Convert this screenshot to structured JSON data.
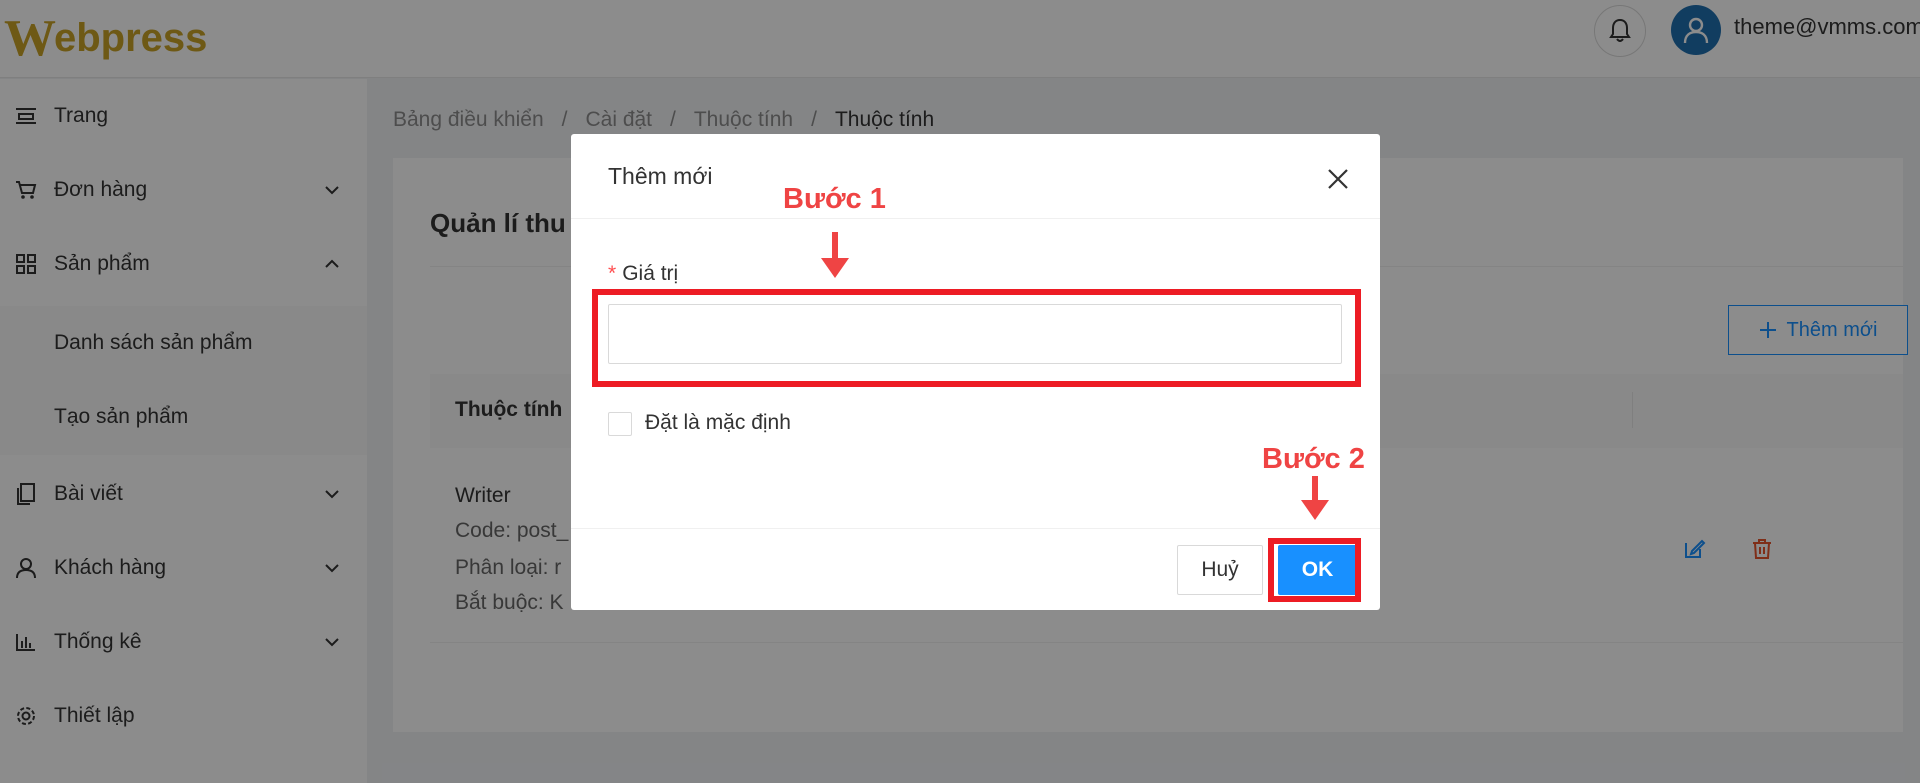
{
  "header": {
    "logo_w": "W",
    "logo_rest": "ebpress",
    "user_email": "theme@vmms.com"
  },
  "sidebar": {
    "items": [
      {
        "label": "Trang",
        "icon": "page-icon"
      },
      {
        "label": "Đơn hàng",
        "icon": "cart-icon",
        "expanded": false
      },
      {
        "label": "Sản phẩm",
        "icon": "grid-icon",
        "expanded": true
      },
      {
        "label": "Bài viết",
        "icon": "document-icon",
        "expanded": false
      },
      {
        "label": "Khách hàng",
        "icon": "user-icon",
        "expanded": false
      },
      {
        "label": "Thống kê",
        "icon": "bar-chart-icon",
        "expanded": false
      },
      {
        "label": "Thiết lập",
        "icon": "gear-icon"
      }
    ],
    "subitems": [
      {
        "label": "Danh sách sản phẩm"
      },
      {
        "label": "Tạo sản phẩm"
      }
    ]
  },
  "breadcrumb": [
    "Bảng điều khiển",
    "Cài đặt",
    "Thuộc tính",
    "Thuộc tính"
  ],
  "main": {
    "title": "Quản lí thu",
    "add_button": "Thêm mới",
    "table_header": "Thuộc tính",
    "row": {
      "title": "Writer",
      "code": "Code:  post_",
      "type": "Phân loại:  r",
      "required": "Bắt buộc:  K"
    }
  },
  "modal": {
    "title": "Thêm mới",
    "required_mark": "*",
    "field_label": "Giá trị",
    "value": "",
    "checkbox_label": "Đặt là mặc định",
    "checkbox_checked": false,
    "cancel": "Huỷ",
    "ok": "OK"
  },
  "annotations": {
    "step1": "Bước 1",
    "step2": "Bước 2",
    "color": "#ed1c24"
  },
  "colors": {
    "primary": "#1890ff",
    "logo_gold": "#c9a227",
    "danger": "#e8552d"
  }
}
